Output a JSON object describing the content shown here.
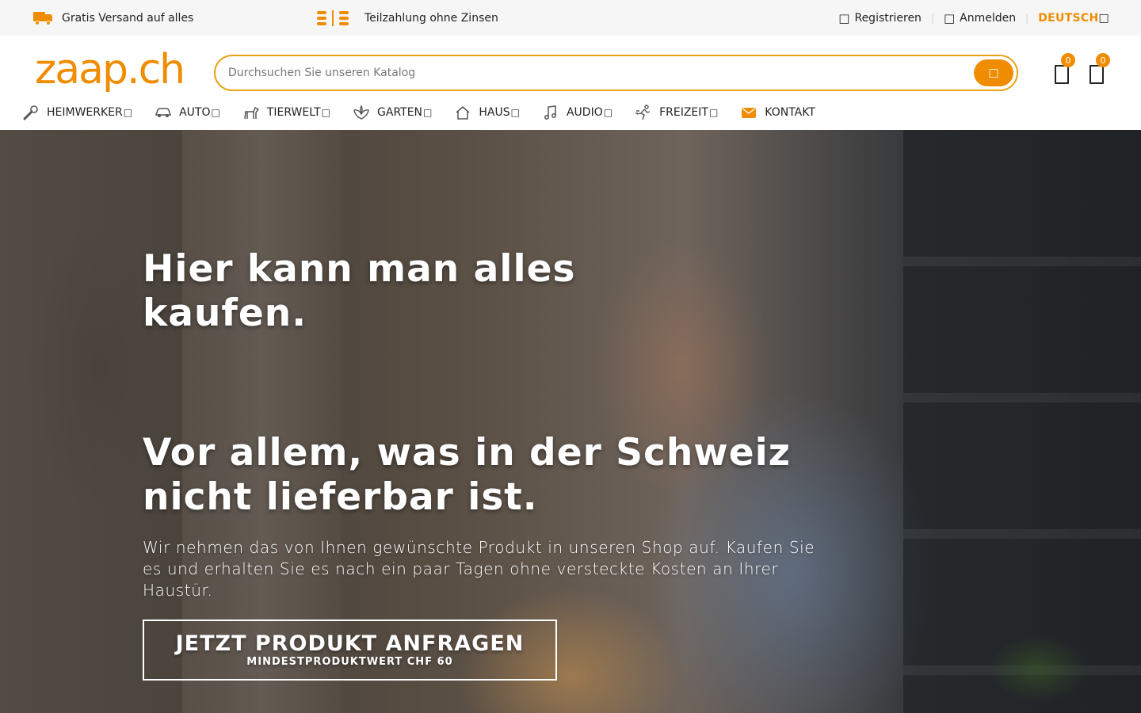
{
  "colors": {
    "accent": "#f08c00",
    "topbar_bg": "#f6f6f6",
    "text": "#232323"
  },
  "topbar": {
    "shipping": {
      "icon": "truck-icon",
      "label": "Gratis Versand auf alles"
    },
    "installment": {
      "icon": "coins-icon",
      "label": "Teilzahlung ohne Zinsen"
    },
    "register": {
      "icon": "user-plus-icon",
      "label": "Registrieren"
    },
    "login": {
      "icon": "user-icon",
      "label": "Anmelden"
    },
    "language": {
      "label": "DEUTSCH",
      "icon": "chevron-down-icon"
    }
  },
  "header": {
    "logo": "zaap.ch",
    "search": {
      "placeholder": "Durchsuchen Sie unseren Katalog",
      "value": "",
      "button_icon": "search-icon"
    },
    "wishlist": {
      "icon": "heart-bag-icon",
      "count": "0"
    },
    "cart": {
      "icon": "shopping-bag-icon",
      "count": "0"
    }
  },
  "nav": {
    "items": [
      {
        "label": "HEIMWERKER",
        "icon": "wrench-icon"
      },
      {
        "label": "AUTO",
        "icon": "car-icon"
      },
      {
        "label": "TIERWELT",
        "icon": "dog-icon"
      },
      {
        "label": "GARTEN",
        "icon": "leaf-icon"
      },
      {
        "label": "HAUS",
        "icon": "house-icon"
      },
      {
        "label": "AUDIO",
        "icon": "music-note-icon"
      },
      {
        "label": "FREIZEIT",
        "icon": "runner-icon"
      },
      {
        "label": "KONTAKT",
        "icon": "envelope-icon"
      }
    ]
  },
  "hero": {
    "headline_1": "Hier kann man alles kaufen.",
    "headline_2": "Vor allem, was in der Schweiz nicht lieferbar ist.",
    "subtext": "Wir nehmen das von Ihnen gewünschte Produkt in unseren Shop auf. Kaufen Sie es und erhalten Sie es nach ein paar Tagen ohne versteckte Kosten an Ihrer Haustür.",
    "cta": {
      "label": "JETZT PRODUKT ANFRAGEN",
      "sublabel": "MINDESTPRODUKTWERT CHF 60"
    }
  }
}
